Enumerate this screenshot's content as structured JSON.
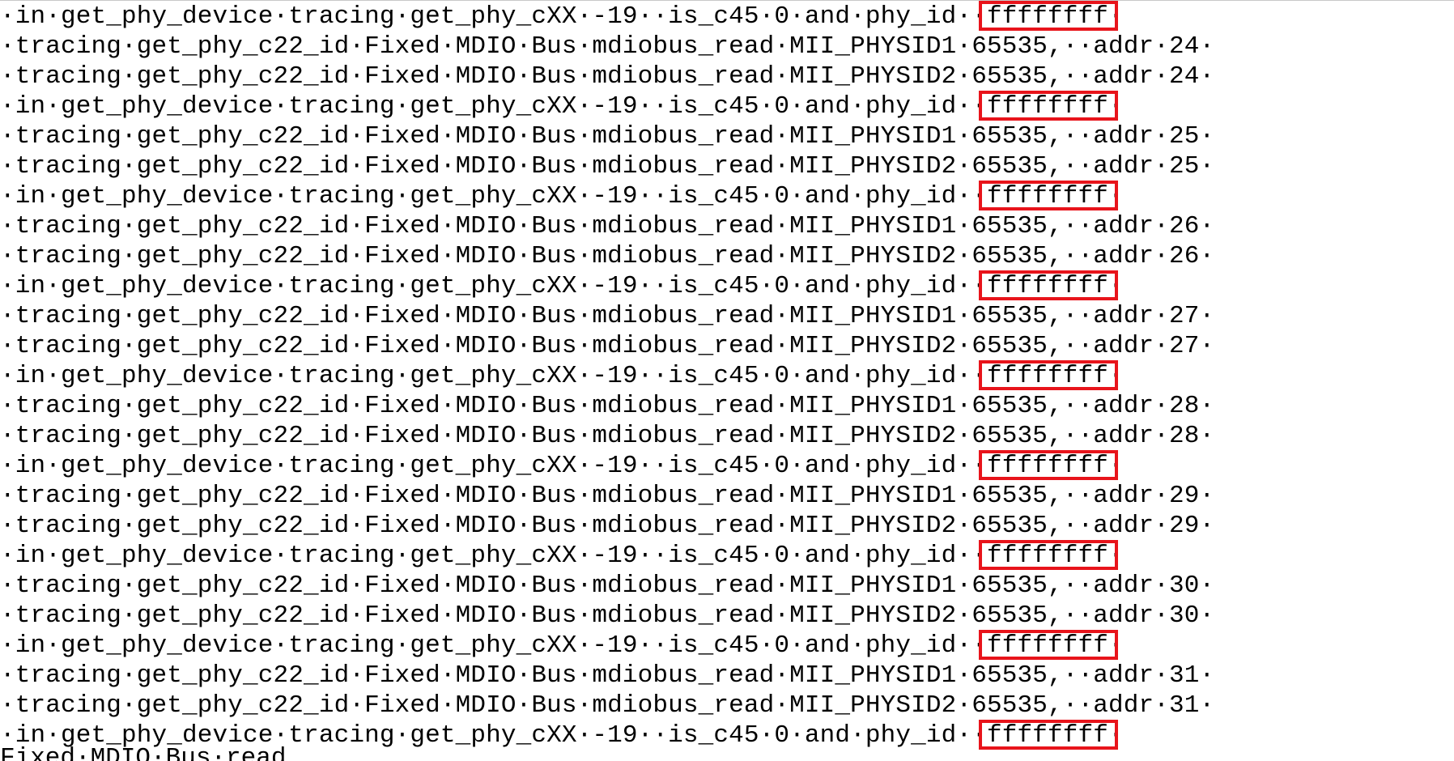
{
  "editor": {
    "lines": [
      "·in·get_phy_device·tracing·get_phy_cXX·-19··is_c45·0·and·phy_id··ffffffff·",
      "·tracing·get_phy_c22_id·Fixed·MDIO·Bus·mdiobus_read·MII_PHYSID1·65535,··addr·24·",
      "·tracing·get_phy_c22_id·Fixed·MDIO·Bus·mdiobus_read·MII_PHYSID2·65535,··addr·24·",
      "·in·get_phy_device·tracing·get_phy_cXX·-19··is_c45·0·and·phy_id··ffffffff·",
      "·tracing·get_phy_c22_id·Fixed·MDIO·Bus·mdiobus_read·MII_PHYSID1·65535,··addr·25·",
      "·tracing·get_phy_c22_id·Fixed·MDIO·Bus·mdiobus_read·MII_PHYSID2·65535,··addr·25·",
      "·in·get_phy_device·tracing·get_phy_cXX·-19··is_c45·0·and·phy_id··ffffffff·",
      "·tracing·get_phy_c22_id·Fixed·MDIO·Bus·mdiobus_read·MII_PHYSID1·65535,··addr·26·",
      "·tracing·get_phy_c22_id·Fixed·MDIO·Bus·mdiobus_read·MII_PHYSID2·65535,··addr·26·",
      "·in·get_phy_device·tracing·get_phy_cXX·-19··is_c45·0·and·phy_id··ffffffff·",
      "·tracing·get_phy_c22_id·Fixed·MDIO·Bus·mdiobus_read·MII_PHYSID1·65535,··addr·27·",
      "·tracing·get_phy_c22_id·Fixed·MDIO·Bus·mdiobus_read·MII_PHYSID2·65535,··addr·27·",
      "·in·get_phy_device·tracing·get_phy_cXX·-19··is_c45·0·and·phy_id··ffffffff·",
      "·tracing·get_phy_c22_id·Fixed·MDIO·Bus·mdiobus_read·MII_PHYSID1·65535,··addr·28·",
      "·tracing·get_phy_c22_id·Fixed·MDIO·Bus·mdiobus_read·MII_PHYSID2·65535,··addr·28·",
      "·in·get_phy_device·tracing·get_phy_cXX·-19··is_c45·0·and·phy_id··ffffffff·",
      "·tracing·get_phy_c22_id·Fixed·MDIO·Bus·mdiobus_read·MII_PHYSID1·65535,··addr·29·",
      "·tracing·get_phy_c22_id·Fixed·MDIO·Bus·mdiobus_read·MII_PHYSID2·65535,··addr·29·",
      "·in·get_phy_device·tracing·get_phy_cXX·-19··is_c45·0·and·phy_id··ffffffff·",
      "·tracing·get_phy_c22_id·Fixed·MDIO·Bus·mdiobus_read·MII_PHYSID1·65535,··addr·30·",
      "·tracing·get_phy_c22_id·Fixed·MDIO·Bus·mdiobus_read·MII_PHYSID2·65535,··addr·30·",
      "·in·get_phy_device·tracing·get_phy_cXX·-19··is_c45·0·and·phy_id··ffffffff·",
      "·tracing·get_phy_c22_id·Fixed·MDIO·Bus·mdiobus_read·MII_PHYSID1·65535,··addr·31·",
      "·tracing·get_phy_c22_id·Fixed·MDIO·Bus·mdiobus_read·MII_PHYSID2·65535,··addr·31·",
      "·in·get_phy_device·tracing·get_phy_cXX·-19··is_c45·0·and·phy_id··ffffffff·"
    ],
    "partial_last_line": "Fixed·MDIO·Bus·read"
  },
  "annotations": {
    "highlight_color": "#e8141b",
    "highlighted_value": "ffffffff"
  }
}
